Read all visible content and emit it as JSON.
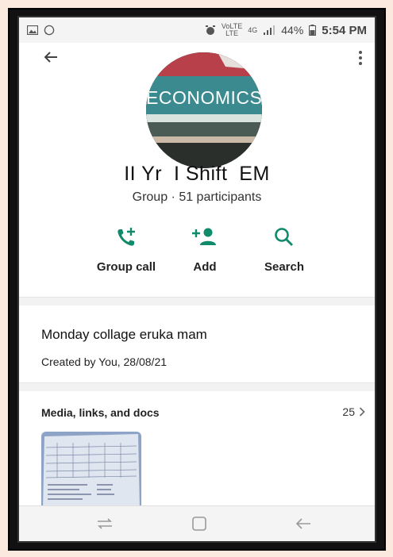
{
  "status_bar": {
    "volte_top": "VoLTE",
    "lte_label": "LTE",
    "network": "4G",
    "battery": "44%",
    "time": "5:54 PM"
  },
  "avatar": {
    "text": "ECONOMICS"
  },
  "group": {
    "name": "II Yr  I Shift  EM",
    "subtitle": "Group · 51 participants"
  },
  "actions": [
    {
      "label": "Group call",
      "icon": "add-call-icon"
    },
    {
      "label": "Add",
      "icon": "add-person-icon"
    },
    {
      "label": "Search",
      "icon": "search-icon"
    }
  ],
  "description": {
    "title": "Monday collage eruka mam",
    "meta": "Created by You, 28/08/21"
  },
  "media": {
    "title": "Media, links, and docs",
    "count": "25"
  },
  "colors": {
    "accent": "#0f8a6a",
    "page_bg": "#fbe9e0",
    "frame": "#111111"
  }
}
